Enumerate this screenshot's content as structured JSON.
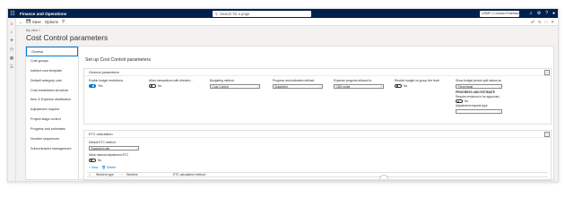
{
  "topbar": {
    "app_name": "Finance and Operations",
    "search_placeholder": "Search for a page",
    "company": "USMF | Contoso Entertainment Syste...",
    "icons": [
      "waffle-icon",
      "search-icon",
      "bell-icon",
      "gear-icon",
      "help-icon",
      "user-icon"
    ]
  },
  "actionpane": {
    "save_label": "Save",
    "options_label": "Options"
  },
  "header": {
    "view_selector": "My view",
    "title": "Cost Control parameters"
  },
  "tabs": [
    {
      "label": "General"
    },
    {
      "label": "Cost groups"
    },
    {
      "label": "Indirect cost template"
    },
    {
      "label": "Default category cost"
    },
    {
      "label": "Cost breakdown structure"
    },
    {
      "label": "Item & Expense distribution"
    },
    {
      "label": "Adjustment request"
    },
    {
      "label": "Project stage control"
    },
    {
      "label": "Progress and estimates"
    },
    {
      "label": "Number sequences"
    },
    {
      "label": "Subcontractor management"
    }
  ],
  "section_title": "Set up Cost Control parameters",
  "general": {
    "header": "General parameters",
    "enable_budget": {
      "label": "Enable budget restrictions",
      "value": "Yes"
    },
    "allow_direct": {
      "label": "Allow transactions with directed...",
      "value": "No"
    },
    "budgeting_method": {
      "label": "Budgeting method",
      "value": "Cost Control"
    },
    "progress_defined": {
      "label": "Progress and estimates defined",
      "value": "Budgeted"
    },
    "expense_progress": {
      "label": "Expense progress allowed to",
      "value": "CBS roster"
    },
    "restrict_budget": {
      "label": "Restrict budget on group line level",
      "value": "No"
    },
    "show_budget": {
      "label": "Show budget period split values as",
      "value": "Percentage"
    },
    "progress_subhead": "PROGRESS AND ESTIMATE",
    "require_revisions": {
      "label": "Require revisions to be approved...",
      "value": "No"
    },
    "adjustment_type": {
      "label": "Adjustment request type",
      "value": ""
    }
  },
  "etc": {
    "header": "ETC calculation",
    "default_method": {
      "label": "Default ETC method",
      "value": "Budgeted rate"
    },
    "allow_manual": {
      "label": "Allow manual adjustment ETC",
      "value": "No"
    },
    "new_label": "New",
    "delete_label": "Delete",
    "columns": [
      "Workers type",
      "Workers",
      "ETC calculation method"
    ]
  }
}
